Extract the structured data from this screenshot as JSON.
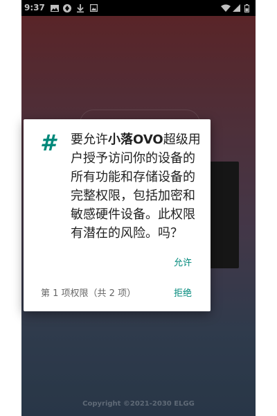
{
  "status_bar": {
    "time": "9:37",
    "icons_left": [
      "image-icon",
      "shield-icon",
      "download-icon",
      "photo-icon"
    ],
    "icons_right": [
      "wifi-icon",
      "signal-icon",
      "battery-icon"
    ]
  },
  "dialog": {
    "icon": "hash-icon",
    "icon_glyph": "#",
    "message_prefix": "要允许",
    "app_name": "小落OVO",
    "message_suffix": "超级用户授予访问你的设备的所有功能和存储设备的完整权限，包括加密和敏感硬件设备。此权限有潜在的风险。吗？",
    "allow_label": "允许",
    "counter": "第 1 项权限（共 2 项）",
    "deny_label": "拒绝",
    "accent_color": "#00897b"
  },
  "footer": {
    "copyright": "Copyright ©2021-2030 ELGG"
  }
}
